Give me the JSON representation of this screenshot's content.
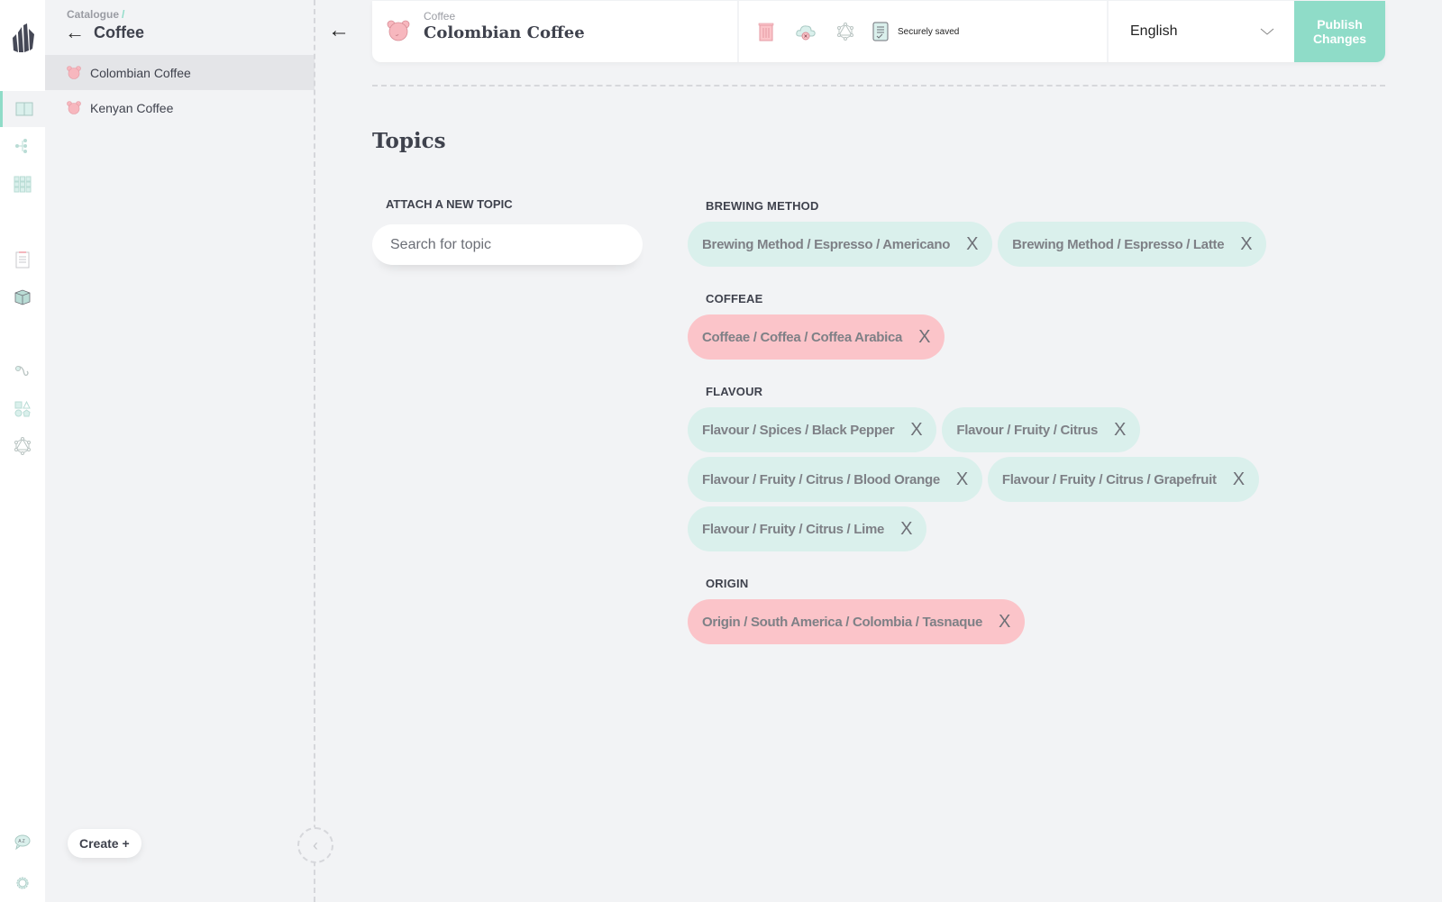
{
  "rail": {
    "logo": "crystal-logo",
    "items": [
      {
        "name": "catalogue-icon",
        "active": true
      },
      {
        "name": "tree-icon",
        "active": false
      },
      {
        "name": "grid-icon",
        "active": false
      },
      {
        "name": "clipboard-icon",
        "active": false
      },
      {
        "name": "box-icon",
        "active": false
      },
      {
        "name": "hook-icon",
        "active": false
      },
      {
        "name": "shapes-icon",
        "active": false
      },
      {
        "name": "graphql-icon",
        "active": false
      },
      {
        "name": "translate-icon",
        "active": false
      },
      {
        "name": "gear-icon",
        "active": false
      }
    ]
  },
  "sidebar": {
    "breadcrumb": "Catalogue",
    "breadcrumb_sep": "/",
    "back_icon": "←",
    "title": "Coffee",
    "items": [
      {
        "label": "Colombian Coffee",
        "selected": true
      },
      {
        "label": "Kenyan Coffee",
        "selected": false
      }
    ],
    "create_label": "Create +",
    "collapse_icon": "‹"
  },
  "topbar": {
    "back_icon": "←",
    "breadcrumb": "Coffee",
    "title": "Colombian Coffee",
    "actions": [
      "trash-icon",
      "cloud-unpublish-icon",
      "graphql-icon",
      "saved-doc-icon"
    ],
    "status": "Securely saved",
    "language": "English",
    "publish_label": "Publish Changes"
  },
  "main": {
    "section_title": "Topics",
    "attach_label": "ATTACH A NEW TOPIC",
    "search_placeholder": "Search for topic",
    "search_value": "",
    "colors": {
      "green_chip": "#daf0ec",
      "pink_chip": "#fbc4c9",
      "accent": "#8fdcc8"
    },
    "groups": [
      {
        "label": "BREWING METHOD",
        "color": "green",
        "topics": [
          "Brewing Method / Espresso / Americano",
          "Brewing Method / Espresso / Latte"
        ]
      },
      {
        "label": "COFFEAE",
        "color": "pink",
        "topics": [
          "Coffeae / Coffea / Coffea Arabica"
        ]
      },
      {
        "label": "FLAVOUR",
        "color": "green",
        "topics": [
          "Flavour / Spices / Black Pepper",
          "Flavour / Fruity / Citrus",
          "Flavour / Fruity / Citrus / Blood Orange",
          "Flavour / Fruity / Citrus / Grapefruit",
          "Flavour / Fruity / Citrus / Lime"
        ]
      },
      {
        "label": "ORIGIN",
        "color": "pink",
        "topics": [
          "Origin / South America / Colombia / Tasnaque"
        ]
      }
    ],
    "remove_icon": "X"
  }
}
